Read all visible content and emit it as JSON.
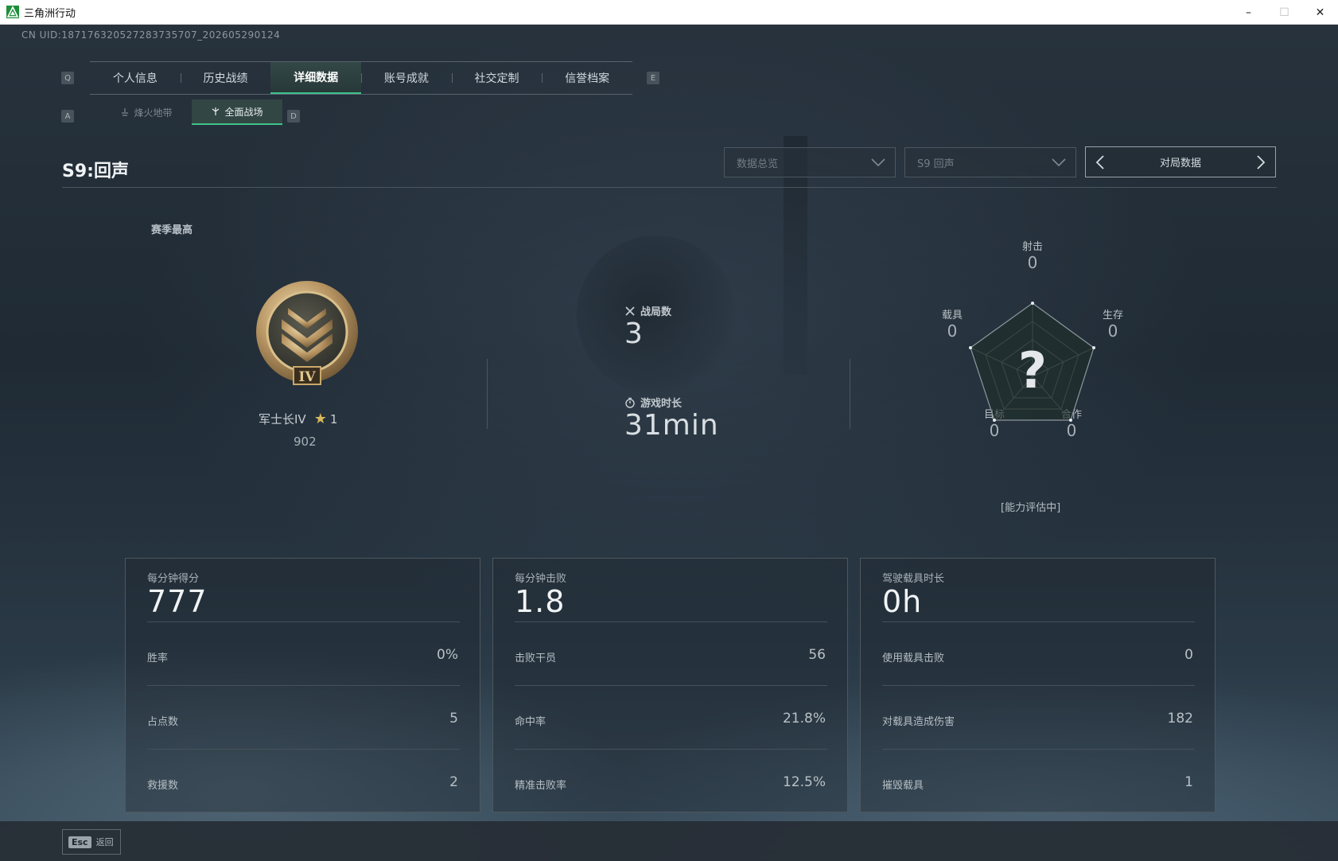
{
  "window": {
    "title": "三角洲行动",
    "controls": {
      "minimize": "–",
      "maximize": "☐",
      "close": "✕"
    }
  },
  "uid": "CN UID:18717632052728373570​7_202605290124",
  "nav": {
    "key_left": "Q",
    "key_right": "E",
    "tabs": [
      "个人信息",
      "历史战绩",
      "详细数据",
      "账号成就",
      "社交定制",
      "信誉档案"
    ],
    "active_tab": "详细数据"
  },
  "subnav": {
    "key_left": "A",
    "key_right": "D",
    "tabs": [
      "烽火地带",
      "全面战场"
    ],
    "active_tab": "全面战场"
  },
  "header": {
    "season_title": "S9:回声",
    "dropdown_view": "数据总览",
    "dropdown_season": "S9 回声",
    "pager_label": "对局数据"
  },
  "rank": {
    "section_label": "赛季最高",
    "name": "军士长IV",
    "stars": "1",
    "points": "902",
    "emblem_numeral": "IV"
  },
  "summary": {
    "matches_label": "战局数",
    "matches_value": "3",
    "time_label": "游戏时长",
    "time_value": "31min"
  },
  "radar": {
    "center_glyph": "?",
    "axes": [
      {
        "label": "射击",
        "value": "0"
      },
      {
        "label": "生存",
        "value": "0"
      },
      {
        "label": "合作",
        "value": "0"
      },
      {
        "label": "目标",
        "value": "0"
      },
      {
        "label": "载具",
        "value": "0"
      }
    ],
    "status": "[能力评估中]"
  },
  "cards": [
    {
      "title": "每分钟得分",
      "value": "777",
      "rows": [
        {
          "label": "胜率",
          "value": "0%"
        },
        {
          "label": "占点数",
          "value": "5"
        },
        {
          "label": "救援数",
          "value": "2"
        }
      ]
    },
    {
      "title": "每分钟击败",
      "value": "1.8",
      "rows": [
        {
          "label": "击败干员",
          "value": "56"
        },
        {
          "label": "命中率",
          "value": "21.8%"
        },
        {
          "label": "精准击败率",
          "value": "12.5%"
        }
      ]
    },
    {
      "title": "驾驶载具时长",
      "value": "0h",
      "rows": [
        {
          "label": "使用载具击败",
          "value": "0"
        },
        {
          "label": "对载具造成伤害",
          "value": "182"
        },
        {
          "label": "摧毁载具",
          "value": "1"
        }
      ]
    }
  ],
  "footer": {
    "esc_key": "Esc",
    "back_label": "返回"
  },
  "colors": {
    "accent": "#3ec28a",
    "gold": "#c9a86a",
    "background": "#1f2a34"
  }
}
